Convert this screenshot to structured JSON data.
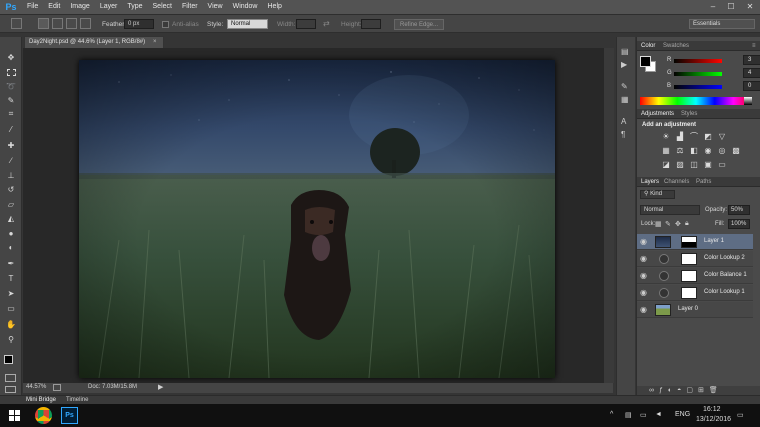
{
  "app": {
    "logo": "Ps",
    "menu": [
      "File",
      "Edit",
      "Image",
      "Layer",
      "Type",
      "Select",
      "Filter",
      "View",
      "Window",
      "Help"
    ]
  },
  "window_controls": {
    "minimize": "–",
    "maximize": "☐",
    "close": "✕"
  },
  "options_bar": {
    "feather_label": "Feather:",
    "feather_value": "0 px",
    "antialias_label": "Anti-alias",
    "style_label": "Style:",
    "style_value": "Normal",
    "width_label": "Width:",
    "height_label": "Height:",
    "refine_edge": "Refine Edge...",
    "workspace": "Essentials"
  },
  "document": {
    "tab_title": "Day2Night.psd @ 44.6% (Layer 1, RGB/8#)",
    "tab_close": "×"
  },
  "status_bar": {
    "zoom": "44.57%",
    "doc_size": "Doc: 7.03M/15.8M"
  },
  "bottom_tabs": [
    "Mini Bridge",
    "Timeline"
  ],
  "tools": [
    "move",
    "marquee",
    "lasso",
    "quick-select",
    "crop",
    "eyedropper",
    "spot-heal",
    "brush",
    "clone-stamp",
    "history-brush",
    "eraser",
    "gradient",
    "blur",
    "dodge",
    "pen",
    "type",
    "path-select",
    "shape",
    "hand",
    "zoom"
  ],
  "colors": {
    "accent": "#31a8ff",
    "selected_layer": "#5e6d84",
    "panel_bg": "#4a4a4a",
    "app_bg": "#353535"
  },
  "color_panel": {
    "tabs": [
      "Color",
      "Swatches"
    ],
    "channels": [
      {
        "label": "R",
        "value": "3",
        "level": 0.01
      },
      {
        "label": "G",
        "value": "4",
        "level": 0.02
      },
      {
        "label": "B",
        "value": "0",
        "level": 0.0
      }
    ]
  },
  "adjustments_panel": {
    "tabs": [
      "Adjustments",
      "Styles"
    ],
    "add_label": "Add an adjustment"
  },
  "layers_panel": {
    "tabs": [
      "Layers",
      "Channels",
      "Paths"
    ],
    "kind_label": "Kind",
    "blend_mode": "Normal",
    "opacity_label": "Opacity:",
    "opacity_value": "50%",
    "lock_label": "Lock:",
    "fill_label": "Fill:",
    "fill_value": "100%",
    "layers": [
      {
        "name": "Layer 1",
        "selected": true,
        "type": "pixel-mask"
      },
      {
        "name": "Color Lookup 2",
        "selected": false,
        "type": "adjustment"
      },
      {
        "name": "Color Balance 1",
        "selected": false,
        "type": "adjustment"
      },
      {
        "name": "Color Lookup 1",
        "selected": false,
        "type": "adjustment"
      },
      {
        "name": "Layer 0",
        "selected": false,
        "type": "photo"
      }
    ]
  },
  "taskbar": {
    "lang": "ENG",
    "time": "16:12",
    "date": "13/12/2016"
  }
}
